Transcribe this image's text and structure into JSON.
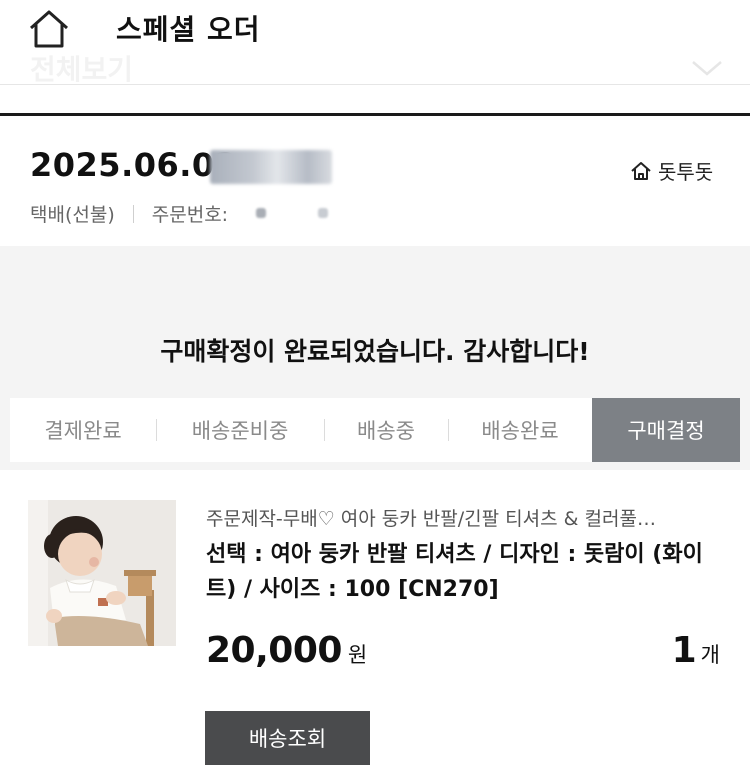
{
  "header": {
    "title": "스페셜 오더",
    "view_all": "전체보기"
  },
  "order": {
    "date": "2025.06.02",
    "shipping": "택배(선불)",
    "order_number_label": "주문번호:",
    "shop_name": "돗투돗"
  },
  "status": {
    "message": "구매확정이 완료되었습니다. 감사합니다!",
    "steps": [
      {
        "label": "결제완료",
        "active": false
      },
      {
        "label": "배송준비중",
        "active": false
      },
      {
        "label": "배송중",
        "active": false
      },
      {
        "label": "배송완료",
        "active": false
      },
      {
        "label": "구매결정",
        "active": true
      }
    ]
  },
  "product": {
    "name": "주문제작-무배♡ 여아 둥카 반팔/긴팔 티셔츠 & 컬러풀…",
    "option": "선택 : 여아 둥카 반팔 티셔츠 / 디자인 : 돗람이 (화이트) / 사이즈 : 100 [CN270]",
    "price": "20,000",
    "currency": "원",
    "quantity": "1",
    "quantity_unit": "개",
    "track_button": "배송조회"
  },
  "colors": {
    "active_step_bg": "#7d8186",
    "button_bg": "#4a4b4d",
    "panel_bg": "#f4f4f4"
  }
}
